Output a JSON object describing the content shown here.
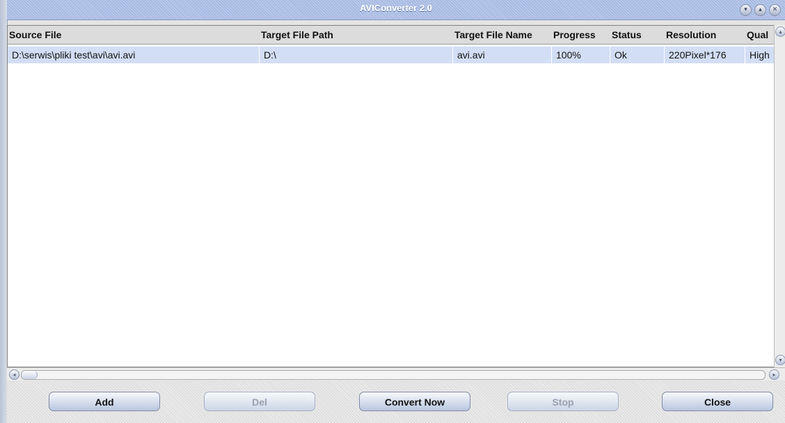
{
  "window": {
    "title": "AVIConverter 2.0",
    "controls": {
      "minimize_icon": "▾",
      "maximize_icon": "▴",
      "close_icon": "✕"
    }
  },
  "table": {
    "columns": [
      "Source File",
      "Target File Path",
      "Target File Name",
      "Progress",
      "Status",
      "Resolution",
      "Qual"
    ],
    "rows": [
      {
        "source_file": "D:\\serwis\\pliki test\\avi\\avi.avi",
        "target_file_path": "D:\\",
        "target_file_name": "avi.avi",
        "progress": "100%",
        "status": "Ok",
        "resolution": "220Pixel*176",
        "quality": "High"
      }
    ]
  },
  "scrollbar": {
    "up_icon": "▴",
    "down_icon": "▾",
    "left_icon": "◂",
    "right_icon": "▸"
  },
  "buttons": {
    "add": "Add",
    "del": "Del",
    "convert_now": "Convert Now",
    "stop": "Stop",
    "close": "Close"
  }
}
